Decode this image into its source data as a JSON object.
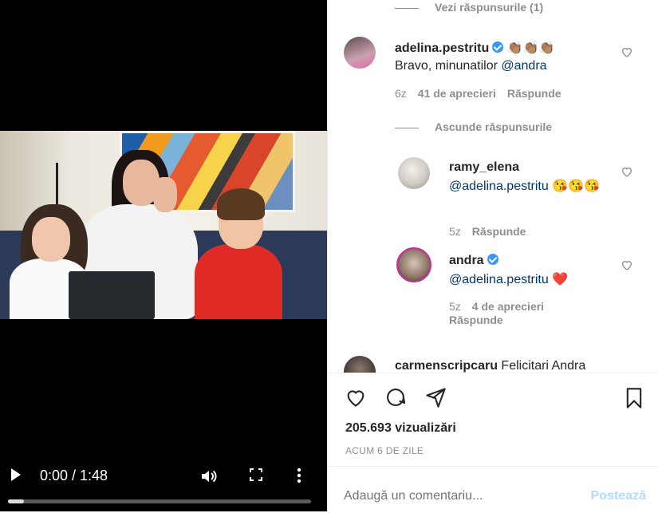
{
  "video": {
    "time_display": "0:00 / 1:48",
    "progress": 0.0
  },
  "comments": {
    "view_replies": "Vezi răspunsurile (1)",
    "hide_replies": "Ascunde răspunsurile",
    "items": [
      {
        "username": "adelina.pestritu",
        "verified": true,
        "emojis": "👏🏽👏🏽👏🏽",
        "text": "Bravo, minunatilor ",
        "mention": "@andra",
        "time": "6z",
        "likes": "41 de aprecieri",
        "reply": "Răspunde"
      },
      {
        "username": "ramy_elena",
        "verified": false,
        "mention": "@adelina.pestritu",
        "emojis": "😘😘😘",
        "time": "5z",
        "reply": "Răspunde"
      },
      {
        "username": "andra",
        "verified": true,
        "mention": "@adelina.pestritu",
        "emojis": "❤️",
        "time": "5z",
        "likes": "4 de aprecieri",
        "reply": "Răspunde"
      },
      {
        "username": "carmenscripcaru",
        "text": "Felicitari Andra"
      }
    ]
  },
  "stats": {
    "views": "205.693 vizualizări",
    "date": "ACUM 6 DE ZILE"
  },
  "composer": {
    "placeholder": "Adaugă un comentariu...",
    "post_label": "Postează"
  }
}
